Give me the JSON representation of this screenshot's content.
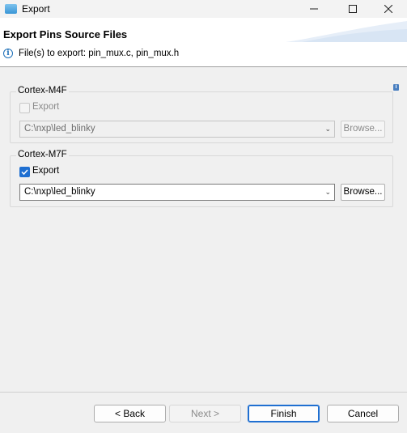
{
  "window": {
    "title": "Export",
    "minimize_icon": "minimize-icon",
    "maximize_icon": "maximize-icon",
    "close_icon": "close-icon"
  },
  "header": {
    "title": "Export Pins Source Files",
    "message": "File(s) to export: pin_mux.c, pin_mux.h",
    "info_icon": "info-icon"
  },
  "groups": [
    {
      "name": "Cortex-M4F",
      "export_label": "Export",
      "export_checked": false,
      "enabled": false,
      "path": "C:\\nxp\\led_blinky",
      "browse_label": "Browse..."
    },
    {
      "name": "Cortex-M7F",
      "export_label": "Export",
      "export_checked": true,
      "enabled": true,
      "path": "C:\\nxp\\led_blinky",
      "browse_label": "Browse..."
    }
  ],
  "footer": {
    "back_label": "< Back",
    "next_label": "Next >",
    "finish_label": "Finish",
    "cancel_label": "Cancel"
  },
  "colors": {
    "accent": "#1f6fd1",
    "info": "#1d6fb8"
  }
}
